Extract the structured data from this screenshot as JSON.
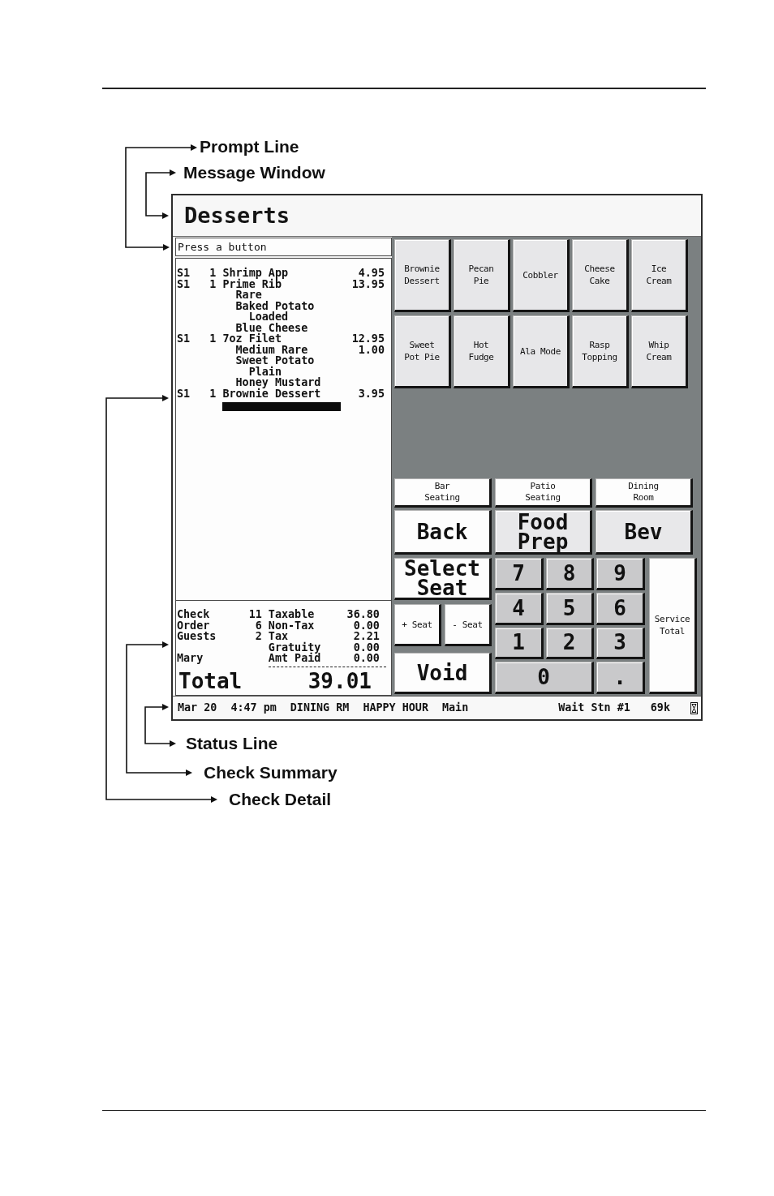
{
  "callouts_above": [
    {
      "label": "Prompt Line"
    },
    {
      "label": "Message Window"
    }
  ],
  "window": {
    "title": "Desserts",
    "prompt": "Press a button"
  },
  "check_detail": {
    "items": [
      {
        "seat": "S1",
        "qty": "1",
        "name": "Shrimp App",
        "price": "4.95"
      },
      {
        "seat": "S1",
        "qty": "1",
        "name": "Prime Rib",
        "price": "13.95",
        "modifiers": [
          {
            "name": "Rare"
          },
          {
            "name": "Baked Potato",
            "children": [
              {
                "name": "Loaded"
              }
            ]
          },
          {
            "name": "Blue Cheese"
          }
        ]
      },
      {
        "seat": "S1",
        "qty": "1",
        "name": "7oz Filet",
        "price": "12.95",
        "modifiers": [
          {
            "name": "Medium Rare",
            "price": "1.00"
          },
          {
            "name": "Sweet Potato",
            "children": [
              {
                "name": "Plain"
              }
            ]
          },
          {
            "name": "Honey Mustard"
          }
        ]
      },
      {
        "seat": "S1",
        "qty": "1",
        "name": "Brownie Dessert",
        "price": "3.95"
      }
    ]
  },
  "check_summary": {
    "counts": [
      {
        "label": "Check",
        "value": "11"
      },
      {
        "label": "Order",
        "value": "6"
      },
      {
        "label": "Guests",
        "value": "2"
      }
    ],
    "server": "Mary",
    "amounts": [
      {
        "label": "Taxable",
        "value": "36.80"
      },
      {
        "label": "Non-Tax",
        "value": "0.00"
      },
      {
        "label": "Tax",
        "value": "2.21"
      },
      {
        "label": "Gratuity",
        "value": "0.00"
      },
      {
        "label": "Amt Paid",
        "value": "0.00"
      }
    ],
    "total": {
      "label": "Total",
      "value": "39.01"
    }
  },
  "menu_buttons": [
    "Brownie\nDessert",
    "Pecan\nPie",
    "Cobbler",
    "Cheese\nCake",
    "Ice\nCream",
    "Sweet\nPot Pie",
    "Hot\nFudge",
    "Ala Mode",
    "Rasp\nTopping",
    "Whip\nCream"
  ],
  "seating_buttons": [
    "Bar\nSeating",
    "Patio\nSeating",
    "Dining\nRoom"
  ],
  "function_buttons": [
    {
      "label": "Back",
      "color": "#fdfdfd"
    },
    {
      "label": "Food\nPrep",
      "color": "#e8e8ea"
    },
    {
      "label": "Bev",
      "color": "#e8e8ea"
    }
  ],
  "seat_buttons": {
    "select": "Select\nSeat",
    "add": "+ Seat",
    "remove": "- Seat"
  },
  "void_button": "Void",
  "keypad": [
    {
      "label": "7",
      "wide": false
    },
    {
      "label": "8",
      "wide": false
    },
    {
      "label": "9",
      "wide": false
    },
    {
      "label": "4",
      "wide": false
    },
    {
      "label": "5",
      "wide": false
    },
    {
      "label": "6",
      "wide": false
    },
    {
      "label": "1",
      "wide": false
    },
    {
      "label": "2",
      "wide": false
    },
    {
      "label": "3",
      "wide": false
    },
    {
      "label": "0",
      "wide": true
    },
    {
      "label": ".",
      "wide": false
    }
  ],
  "service_total_button": "Service\nTotal",
  "status_bar": {
    "left": [
      "Mar 20",
      "4:47 pm",
      "DINING RM",
      "HAPPY HOUR",
      "Main"
    ],
    "right": [
      "Wait Stn #1",
      "69k"
    ]
  },
  "callouts_below": [
    {
      "label": "Status Line"
    },
    {
      "label": "Check Summary"
    },
    {
      "label": "Check Detail"
    }
  ]
}
